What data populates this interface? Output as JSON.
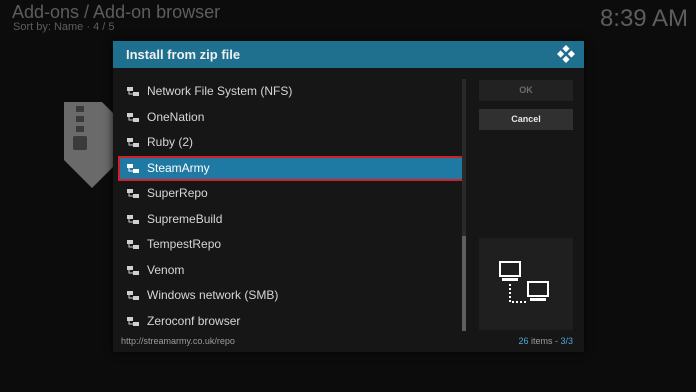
{
  "background": {
    "title": "Add-ons / Add-on browser",
    "sort": "Sort by: Name  ·  4 / 5",
    "clock": "8:39 AM"
  },
  "dialog": {
    "title": "Install from zip file",
    "items": [
      {
        "label": "Network File System (NFS)",
        "icon": "network-share-icon",
        "selected": false
      },
      {
        "label": "OneNation",
        "icon": "network-share-icon",
        "selected": false
      },
      {
        "label": "Ruby (2)",
        "icon": "network-share-icon",
        "selected": false
      },
      {
        "label": "SteamArmy",
        "icon": "network-share-icon",
        "selected": true
      },
      {
        "label": "SuperRepo",
        "icon": "network-share-icon",
        "selected": false
      },
      {
        "label": "SupremeBuild",
        "icon": "network-share-icon",
        "selected": false
      },
      {
        "label": "TempestRepo",
        "icon": "network-share-icon",
        "selected": false
      },
      {
        "label": "Venom",
        "icon": "network-share-icon",
        "selected": false
      },
      {
        "label": "Windows network (SMB)",
        "icon": "network-share-icon",
        "selected": false
      },
      {
        "label": "Zeroconf browser",
        "icon": "network-share-icon",
        "selected": false
      }
    ],
    "ok_label": "OK",
    "cancel_label": "Cancel",
    "path": "http://streamarmy.co.uk/repo",
    "count_number": "26",
    "count_rest": " items - ",
    "page": "3/3"
  },
  "colors": {
    "header": "#1f6f8f",
    "selection": "#1f7aa3",
    "selection_outline": "#d0202a",
    "accent": "#4fa8d4"
  }
}
